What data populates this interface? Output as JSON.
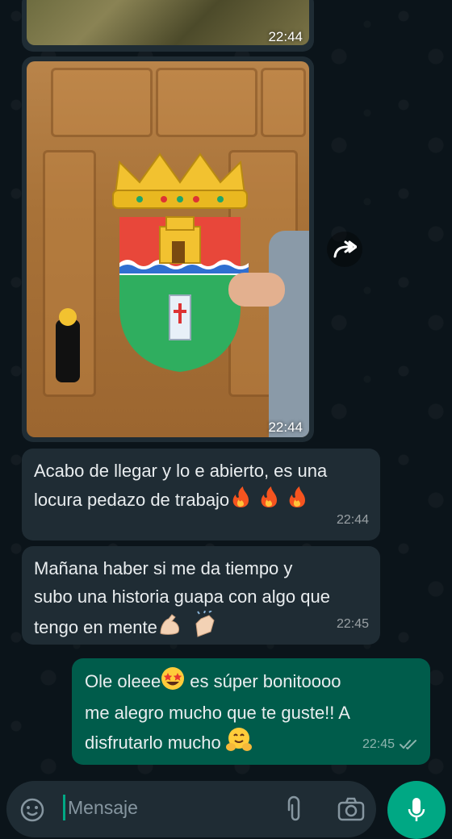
{
  "chat": {
    "media": [
      {
        "time": "22:44"
      },
      {
        "time": "22:44"
      }
    ],
    "messages": [
      {
        "direction": "in",
        "line1": "Acabo de llegar y lo e abierto, es una",
        "line2": "locura pedazo de trabajo",
        "time": "22:44"
      },
      {
        "direction": "in",
        "line1": "Mañana haber si me da tiempo y",
        "line2": "subo una historia guapa con algo que",
        "line3": "tengo en mente",
        "time": "22:45"
      },
      {
        "direction": "out",
        "line1a": "Ole oleee",
        "line1b": " es súper bonitoooo",
        "line2": "me alegro mucho que te guste!! A",
        "line3": "disfrutarlo mucho ",
        "time": "22:45",
        "status": "read"
      }
    ]
  },
  "composer": {
    "placeholder": "Mensaje"
  },
  "icons": {
    "forward": "forward-icon",
    "emoji": "emoji-icon",
    "attach": "attach-icon",
    "camera": "camera-icon",
    "mic": "mic-icon",
    "read_receipt": "double-check-icon"
  },
  "colors": {
    "background": "#0b141a",
    "incoming_bubble": "#1f2c34",
    "outgoing_bubble": "#005c4b",
    "accent": "#00a884"
  }
}
